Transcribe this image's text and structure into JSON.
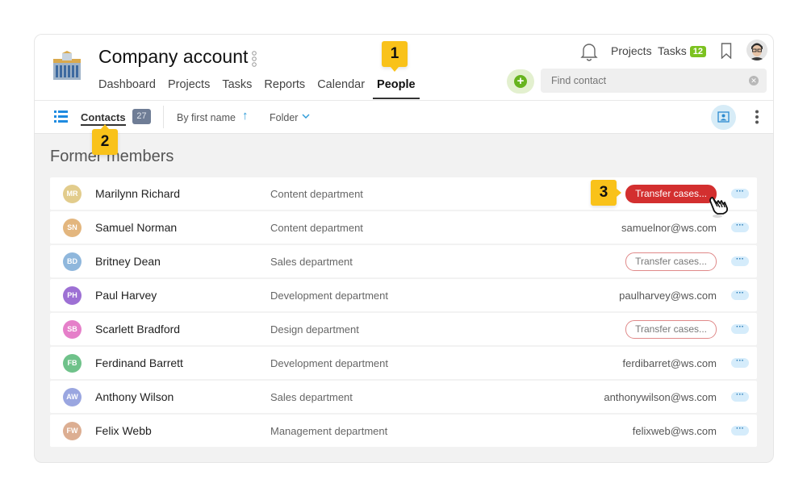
{
  "header": {
    "title": "Company account",
    "nav": [
      "Dashboard",
      "Projects",
      "Tasks",
      "Reports",
      "Calendar",
      "People"
    ],
    "active_nav": "People",
    "links": {
      "projects": "Projects",
      "tasks": "Tasks",
      "tasks_count": "12"
    },
    "search_placeholder": "Find contact"
  },
  "toolbar": {
    "contacts_label": "Contacts",
    "contacts_count": "27",
    "sort_label": "By first name",
    "folder_label": "Folder"
  },
  "section_title": "Former members",
  "members": [
    {
      "initials": "MR",
      "name": "Marilynn Richard",
      "department": "Content department",
      "action": "Transfer cases...",
      "color": "#e2cc8c",
      "highlight": true
    },
    {
      "initials": "SN",
      "name": "Samuel Norman",
      "department": "Content department",
      "email": "samuelnor@ws.com",
      "color": "#e3b67e"
    },
    {
      "initials": "BD",
      "name": "Britney Dean",
      "department": "Sales department",
      "action": "Transfer cases...",
      "color": "#8fb7dc"
    },
    {
      "initials": "PH",
      "name": "Paul Harvey",
      "department": "Development department",
      "email": "paulharvey@ws.com",
      "color": "#9d70d4"
    },
    {
      "initials": "SB",
      "name": "Scarlett Bradford",
      "department": "Design department",
      "action": "Transfer cases...",
      "color": "#e57fc9"
    },
    {
      "initials": "FB",
      "name": "Ferdinand Barrett",
      "department": "Development department",
      "email": "ferdibarret@ws.com",
      "color": "#6fc28a"
    },
    {
      "initials": "AW",
      "name": "Anthony Wilson",
      "department": "Sales department",
      "email": "anthonywilson@ws.com",
      "color": "#9aa6e0"
    },
    {
      "initials": "FW",
      "name": "Felix Webb",
      "department": "Management department",
      "email": "felixweb@ws.com",
      "color": "#dcae92"
    }
  ],
  "markers": [
    "1",
    "2",
    "3"
  ],
  "colors": {
    "accent_green": "#7cc220",
    "transfer_red": "#d32f2f",
    "marker_yellow": "#f9c21a",
    "link_blue": "#2b9ad8"
  }
}
